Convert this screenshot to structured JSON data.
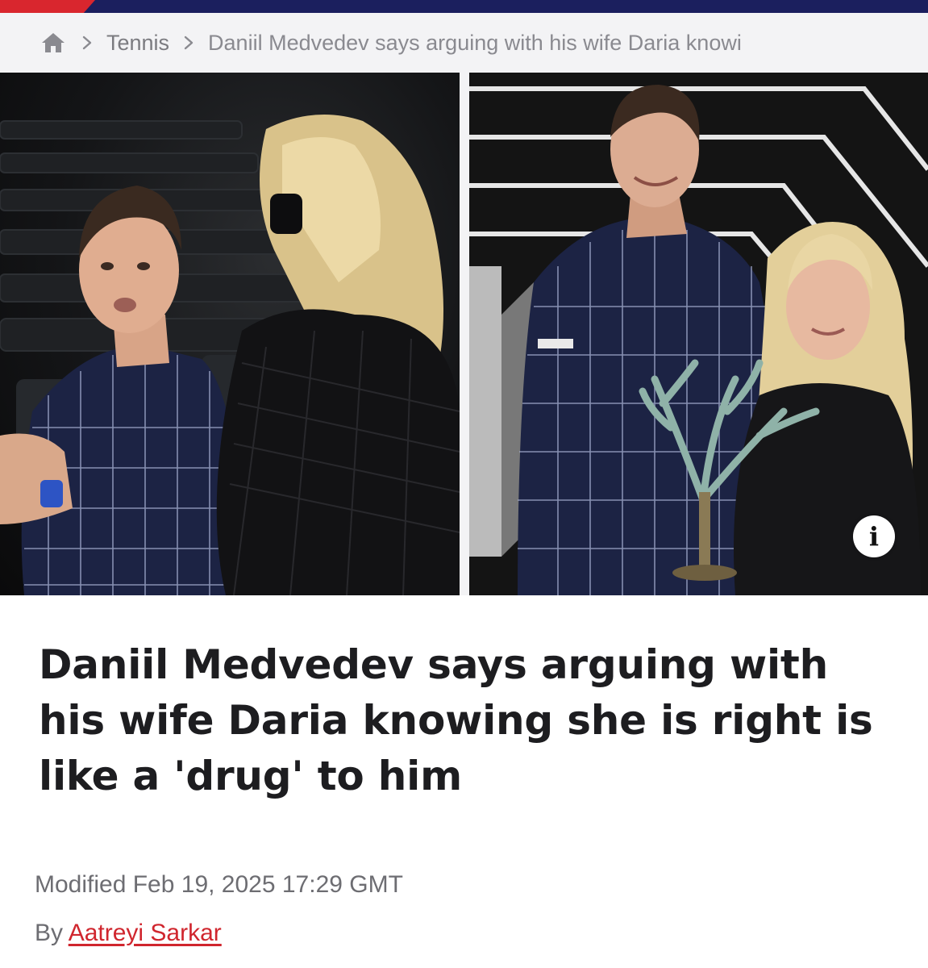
{
  "colors": {
    "brand_navy": "#1b1f5e",
    "brand_red": "#d9262e",
    "breadcrumb_bg": "#f3f3f5",
    "headline": "#1d1d20",
    "author_link": "#d0262e"
  },
  "breadcrumb": {
    "home_icon": "home-icon",
    "separator_icon": "chevron-right-icon",
    "section": "Tennis",
    "current": "Daniil Medvedev says arguing with his wife Daria knowi"
  },
  "hero": {
    "info_icon": "info-icon",
    "info_glyph": "i"
  },
  "article": {
    "headline": "Daniil Medvedev says arguing with his wife Daria knowing she is right is like a 'drug' to him",
    "modified": "Modified Feb 19, 2025 17:29 GMT",
    "by_label": "By",
    "author": "Aatreyi Sarkar"
  }
}
